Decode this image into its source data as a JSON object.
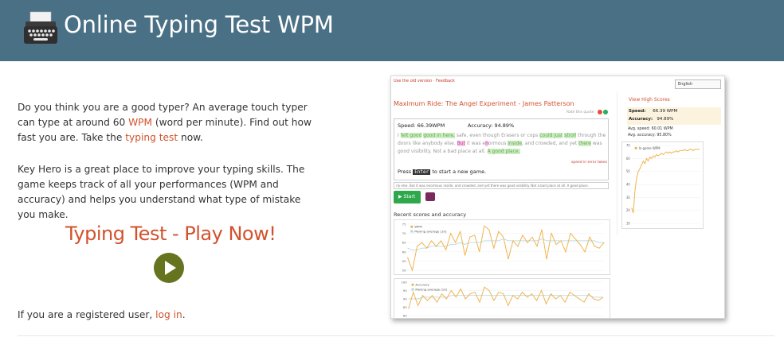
{
  "header": {
    "title": "Online Typing Test WPM",
    "logo_icon": "typewriter-icon"
  },
  "intro": {
    "p1_before": "Do you think you are a good typer? An average touch typer can type at around 60 ",
    "p1_link": "WPM",
    "p1_mid": " (word per minute). Find out how fast you are. Take the ",
    "p1_link2": "typing test",
    "p1_after": " now.",
    "p2": "Key Hero is a great place to improve your typing skills. The game keeps track of all your performances (WPM and accuracy) and helps you understand what type of mistake you make."
  },
  "play": {
    "title": "Typing Test - Play Now!",
    "icon": "play-icon"
  },
  "login": {
    "text": "If you are a registered user, ",
    "link": "log in",
    "after": "."
  },
  "screenshot": {
    "old_version": "Use the old version · Feedback",
    "language": "English",
    "book": "Maximum Ride: The Angel Experiment - James Patterson",
    "rate": "Rate this quote",
    "speed": "Speed:  66.39WPM",
    "accuracy": "Accuracy:  94.89%",
    "quote_parts": [
      {
        "t": "I ",
        "c": "n"
      },
      {
        "t": "felt good",
        "c": "g"
      },
      {
        "t": " ",
        "c": "n"
      },
      {
        "t": "good in here,",
        "c": "g"
      },
      {
        "t": " safe, even though Erasers or cops ",
        "c": "n"
      },
      {
        "t": "could just",
        "c": "g"
      },
      {
        "t": " ",
        "c": "n"
      },
      {
        "t": "stroll",
        "c": "g"
      },
      {
        "t": " through the doors like anybody else. ",
        "c": "n"
      },
      {
        "t": "But",
        "c": "p"
      },
      {
        "t": " it was e",
        "c": "n"
      },
      {
        "t": "n",
        "c": "p"
      },
      {
        "t": "ormous ",
        "c": "n"
      },
      {
        "t": "inside",
        "c": "g"
      },
      {
        "t": ", and crowded, and yet ",
        "c": "n"
      },
      {
        "t": "there",
        "c": "g"
      },
      {
        "t": " was good visibility. Not a bad place at all. ",
        "c": "n"
      },
      {
        "t": "A good place.",
        "c": "g"
      }
    ],
    "speed_note": "speed in error tokes",
    "press_before": "Press ",
    "press_key": "Enter",
    "press_after": " to start a new game.",
    "input_text": "rly else. But it was enormous inside, and crowded, and yet there was good visibility. Not a bad place at all. A good place.",
    "start": "▶ Start",
    "recent": "Recent scores and accuracy",
    "view_high": "View High Scores",
    "hs_speed_label": "Speed:",
    "hs_speed": "66.39 WPM",
    "hs_acc_label": "Accuracy:",
    "hs_acc": "94.89%",
    "avg_speed": "Avg. speed: 60.01 WPM",
    "avg_acc": "Avg. accuracy: 95.80%",
    "legend_wpm": "WPM",
    "legend_mavg": "Moving average (10)",
    "legend_acc": "Accuracy",
    "legend_speed": "In-game WPM",
    "y1_ticks": [
      "75",
      "70",
      "65",
      "60",
      "55",
      "50"
    ],
    "y2_ticks": [
      "100",
      "95",
      "90",
      "85",
      "80"
    ],
    "y3_ticks": [
      "70",
      "60",
      "50",
      "40",
      "30",
      "20",
      "10"
    ],
    "colors": {
      "header_bg": "#4a7085",
      "accent": "#d2522d",
      "play_btn": "#66731f",
      "line_orange": "#f0b24b",
      "line_blue": "#a8d4e6"
    },
    "wpm_series": [
      57,
      50,
      63,
      65,
      62,
      66,
      63,
      66,
      61,
      70,
      65,
      71,
      58,
      68,
      69,
      60,
      74,
      72,
      62,
      71,
      68,
      56,
      66,
      63,
      69,
      65,
      68,
      63,
      72,
      56,
      70,
      64,
      66,
      60,
      70,
      67,
      64,
      60,
      68,
      63,
      62,
      65
    ],
    "mavg_series": [
      62,
      61,
      61,
      62,
      62,
      63,
      63,
      63,
      63,
      64,
      64,
      65,
      64,
      65,
      65,
      65,
      66,
      66,
      66,
      66,
      67,
      66,
      66,
      66,
      66,
      66,
      66,
      66,
      67,
      66,
      66,
      66,
      66,
      66,
      66,
      66,
      66,
      66,
      66,
      66,
      65,
      65
    ],
    "acc_series": [
      84,
      94,
      86,
      92,
      89,
      92,
      88,
      93,
      90,
      95,
      91,
      96,
      90,
      93,
      94,
      88,
      97,
      95,
      89,
      94,
      93,
      86,
      92,
      90,
      94,
      91,
      93,
      89,
      95,
      87,
      93,
      90,
      92,
      88,
      94,
      92,
      90,
      88,
      93,
      90,
      89,
      91
    ],
    "acc_mavg": [
      90,
      90,
      90,
      91,
      91,
      91,
      91,
      91,
      91,
      92,
      92,
      92,
      92,
      92,
      92,
      92,
      92,
      92,
      92,
      92,
      92,
      92,
      92,
      92,
      92,
      92,
      92,
      92,
      92,
      92,
      92,
      92,
      92,
      92,
      92,
      92,
      92,
      92,
      92,
      91,
      91,
      91
    ],
    "ingame_series": [
      22,
      18,
      35,
      45,
      50,
      52,
      55,
      58,
      56,
      60,
      58,
      61,
      60,
      62,
      61,
      63,
      62,
      63,
      64,
      63,
      64,
      65,
      64,
      65,
      64,
      65,
      65,
      66,
      65,
      66,
      66,
      66,
      67,
      66,
      66,
      67,
      67,
      66,
      67,
      67,
      67,
      67
    ]
  }
}
